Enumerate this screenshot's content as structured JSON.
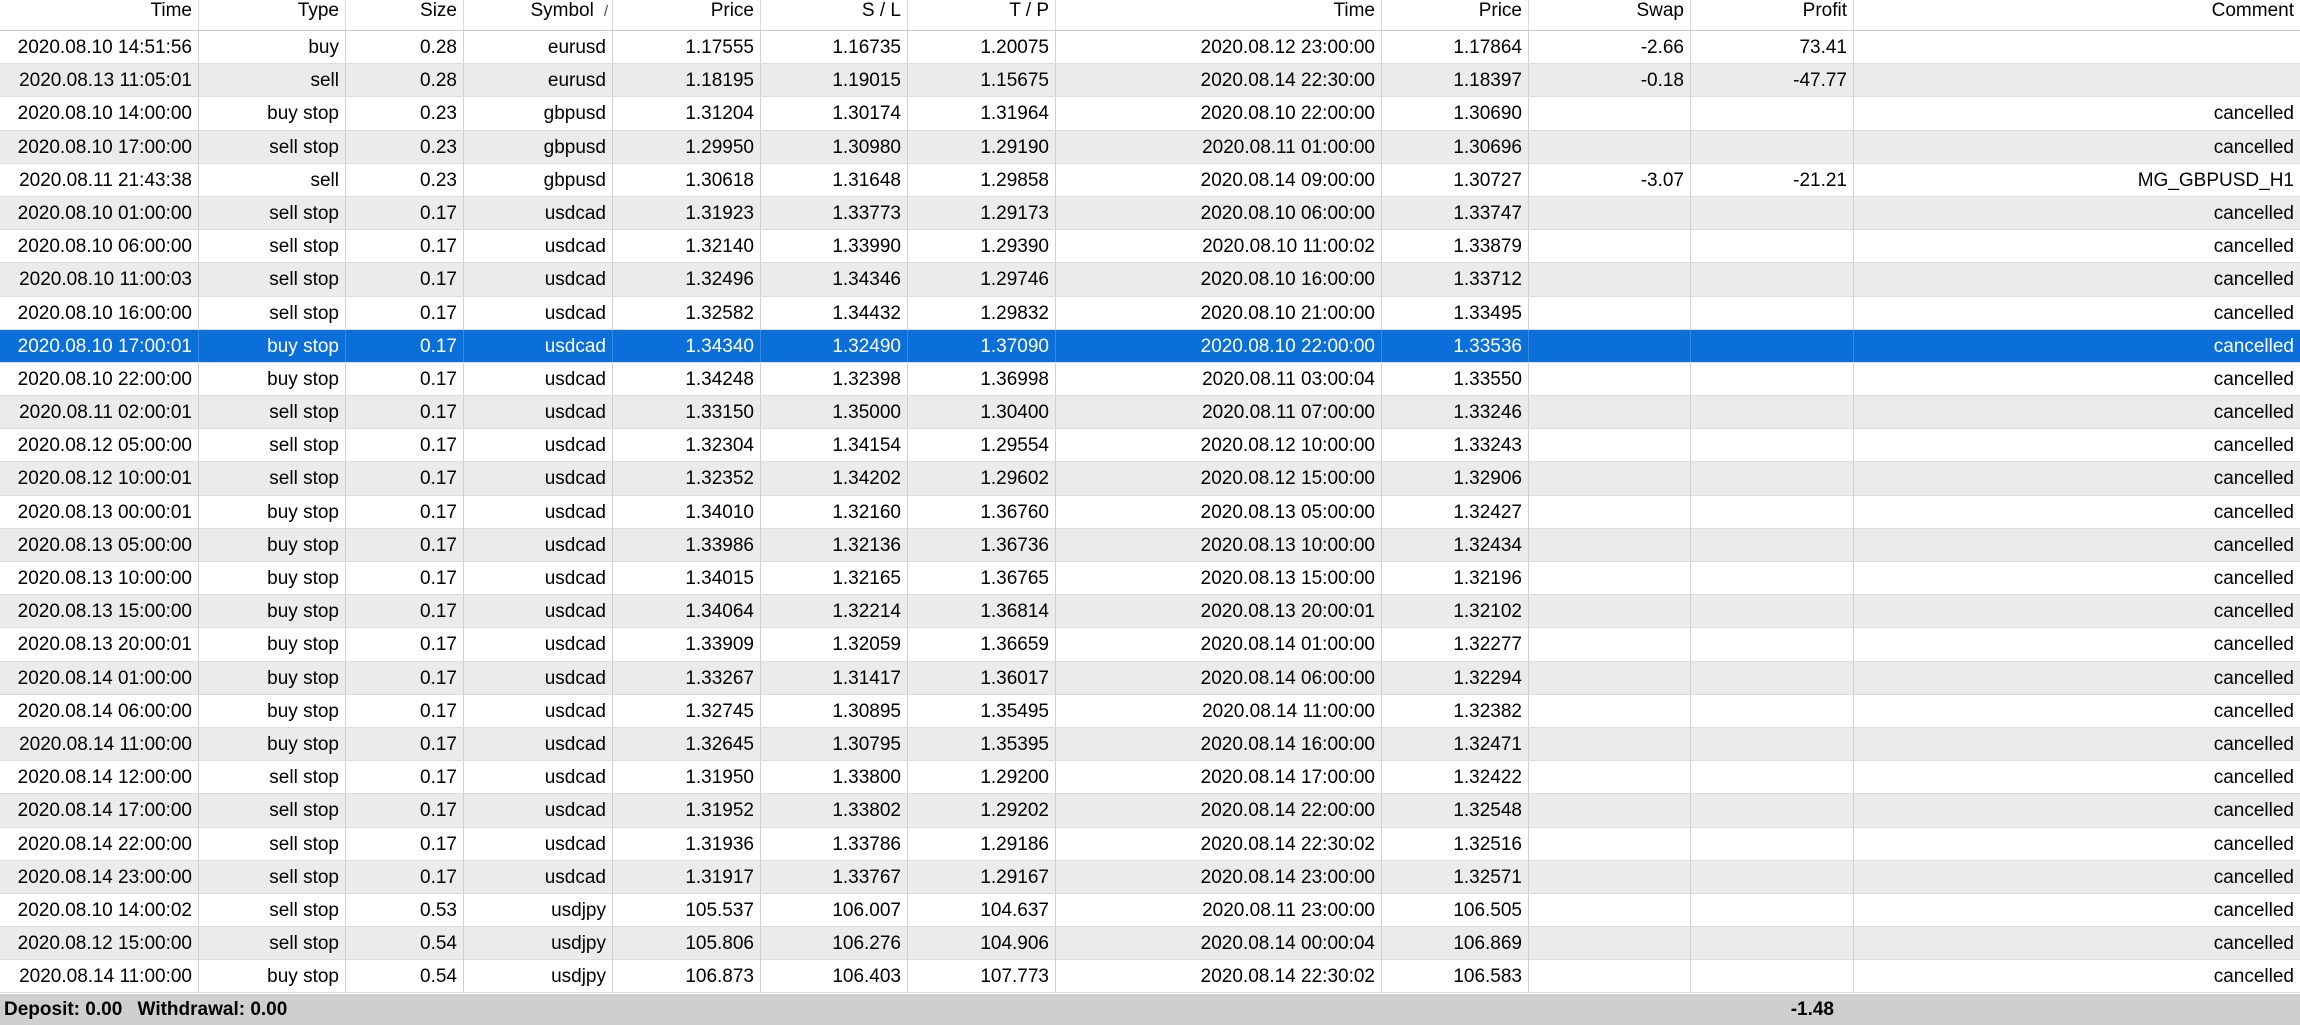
{
  "columns": [
    "Time",
    "Type",
    "Size",
    "Symbol",
    "Price",
    "S / L",
    "T / P",
    "Time",
    "Price",
    "Swap",
    "Profit",
    "Comment"
  ],
  "sort_indicator": "/",
  "rows": [
    [
      "2020.08.10 14:51:56",
      "buy",
      "0.28",
      "eurusd",
      "1.17555",
      "1.16735",
      "1.20075",
      "2020.08.12 23:00:00",
      "1.17864",
      "-2.66",
      "73.41",
      ""
    ],
    [
      "2020.08.13 11:05:01",
      "sell",
      "0.28",
      "eurusd",
      "1.18195",
      "1.19015",
      "1.15675",
      "2020.08.14 22:30:00",
      "1.18397",
      "-0.18",
      "-47.77",
      ""
    ],
    [
      "2020.08.10 14:00:00",
      "buy stop",
      "0.23",
      "gbpusd",
      "1.31204",
      "1.30174",
      "1.31964",
      "2020.08.10 22:00:00",
      "1.30690",
      "",
      "",
      "cancelled"
    ],
    [
      "2020.08.10 17:00:00",
      "sell stop",
      "0.23",
      "gbpusd",
      "1.29950",
      "1.30980",
      "1.29190",
      "2020.08.11 01:00:00",
      "1.30696",
      "",
      "",
      "cancelled"
    ],
    [
      "2020.08.11 21:43:38",
      "sell",
      "0.23",
      "gbpusd",
      "1.30618",
      "1.31648",
      "1.29858",
      "2020.08.14 09:00:00",
      "1.30727",
      "-3.07",
      "-21.21",
      "MG_GBPUSD_H1"
    ],
    [
      "2020.08.10 01:00:00",
      "sell stop",
      "0.17",
      "usdcad",
      "1.31923",
      "1.33773",
      "1.29173",
      "2020.08.10 06:00:00",
      "1.33747",
      "",
      "",
      "cancelled"
    ],
    [
      "2020.08.10 06:00:00",
      "sell stop",
      "0.17",
      "usdcad",
      "1.32140",
      "1.33990",
      "1.29390",
      "2020.08.10 11:00:02",
      "1.33879",
      "",
      "",
      "cancelled"
    ],
    [
      "2020.08.10 11:00:03",
      "sell stop",
      "0.17",
      "usdcad",
      "1.32496",
      "1.34346",
      "1.29746",
      "2020.08.10 16:00:00",
      "1.33712",
      "",
      "",
      "cancelled"
    ],
    [
      "2020.08.10 16:00:00",
      "sell stop",
      "0.17",
      "usdcad",
      "1.32582",
      "1.34432",
      "1.29832",
      "2020.08.10 21:00:00",
      "1.33495",
      "",
      "",
      "cancelled"
    ],
    [
      "2020.08.10 17:00:01",
      "buy stop",
      "0.17",
      "usdcad",
      "1.34340",
      "1.32490",
      "1.37090",
      "2020.08.10 22:00:00",
      "1.33536",
      "",
      "",
      "cancelled"
    ],
    [
      "2020.08.10 22:00:00",
      "buy stop",
      "0.17",
      "usdcad",
      "1.34248",
      "1.32398",
      "1.36998",
      "2020.08.11 03:00:04",
      "1.33550",
      "",
      "",
      "cancelled"
    ],
    [
      "2020.08.11 02:00:01",
      "sell stop",
      "0.17",
      "usdcad",
      "1.33150",
      "1.35000",
      "1.30400",
      "2020.08.11 07:00:00",
      "1.33246",
      "",
      "",
      "cancelled"
    ],
    [
      "2020.08.12 05:00:00",
      "sell stop",
      "0.17",
      "usdcad",
      "1.32304",
      "1.34154",
      "1.29554",
      "2020.08.12 10:00:00",
      "1.33243",
      "",
      "",
      "cancelled"
    ],
    [
      "2020.08.12 10:00:01",
      "sell stop",
      "0.17",
      "usdcad",
      "1.32352",
      "1.34202",
      "1.29602",
      "2020.08.12 15:00:00",
      "1.32906",
      "",
      "",
      "cancelled"
    ],
    [
      "2020.08.13 00:00:01",
      "buy stop",
      "0.17",
      "usdcad",
      "1.34010",
      "1.32160",
      "1.36760",
      "2020.08.13 05:00:00",
      "1.32427",
      "",
      "",
      "cancelled"
    ],
    [
      "2020.08.13 05:00:00",
      "buy stop",
      "0.17",
      "usdcad",
      "1.33986",
      "1.32136",
      "1.36736",
      "2020.08.13 10:00:00",
      "1.32434",
      "",
      "",
      "cancelled"
    ],
    [
      "2020.08.13 10:00:00",
      "buy stop",
      "0.17",
      "usdcad",
      "1.34015",
      "1.32165",
      "1.36765",
      "2020.08.13 15:00:00",
      "1.32196",
      "",
      "",
      "cancelled"
    ],
    [
      "2020.08.13 15:00:00",
      "buy stop",
      "0.17",
      "usdcad",
      "1.34064",
      "1.32214",
      "1.36814",
      "2020.08.13 20:00:01",
      "1.32102",
      "",
      "",
      "cancelled"
    ],
    [
      "2020.08.13 20:00:01",
      "buy stop",
      "0.17",
      "usdcad",
      "1.33909",
      "1.32059",
      "1.36659",
      "2020.08.14 01:00:00",
      "1.32277",
      "",
      "",
      "cancelled"
    ],
    [
      "2020.08.14 01:00:00",
      "buy stop",
      "0.17",
      "usdcad",
      "1.33267",
      "1.31417",
      "1.36017",
      "2020.08.14 06:00:00",
      "1.32294",
      "",
      "",
      "cancelled"
    ],
    [
      "2020.08.14 06:00:00",
      "buy stop",
      "0.17",
      "usdcad",
      "1.32745",
      "1.30895",
      "1.35495",
      "2020.08.14 11:00:00",
      "1.32382",
      "",
      "",
      "cancelled"
    ],
    [
      "2020.08.14 11:00:00",
      "buy stop",
      "0.17",
      "usdcad",
      "1.32645",
      "1.30795",
      "1.35395",
      "2020.08.14 16:00:00",
      "1.32471",
      "",
      "",
      "cancelled"
    ],
    [
      "2020.08.14 12:00:00",
      "sell stop",
      "0.17",
      "usdcad",
      "1.31950",
      "1.33800",
      "1.29200",
      "2020.08.14 17:00:00",
      "1.32422",
      "",
      "",
      "cancelled"
    ],
    [
      "2020.08.14 17:00:00",
      "sell stop",
      "0.17",
      "usdcad",
      "1.31952",
      "1.33802",
      "1.29202",
      "2020.08.14 22:00:00",
      "1.32548",
      "",
      "",
      "cancelled"
    ],
    [
      "2020.08.14 22:00:00",
      "sell stop",
      "0.17",
      "usdcad",
      "1.31936",
      "1.33786",
      "1.29186",
      "2020.08.14 22:30:02",
      "1.32516",
      "",
      "",
      "cancelled"
    ],
    [
      "2020.08.14 23:00:00",
      "sell stop",
      "0.17",
      "usdcad",
      "1.31917",
      "1.33767",
      "1.29167",
      "2020.08.14 23:00:00",
      "1.32571",
      "",
      "",
      "cancelled"
    ],
    [
      "2020.08.10 14:00:02",
      "sell stop",
      "0.53",
      "usdjpy",
      "105.537",
      "106.007",
      "104.637",
      "2020.08.11 23:00:00",
      "106.505",
      "",
      "",
      "cancelled"
    ],
    [
      "2020.08.12 15:00:00",
      "sell stop",
      "0.54",
      "usdjpy",
      "105.806",
      "106.276",
      "104.906",
      "2020.08.14 00:00:04",
      "106.869",
      "",
      "",
      "cancelled"
    ],
    [
      "2020.08.14 11:00:00",
      "buy stop",
      "0.54",
      "usdjpy",
      "106.873",
      "106.403",
      "107.773",
      "2020.08.14 22:30:02",
      "106.583",
      "",
      "",
      "cancelled"
    ]
  ],
  "selected_row": 9,
  "footer": {
    "deposit": "Deposit: 0.00",
    "withdrawal": "Withdrawal: 0.00",
    "total_profit": "-1.48"
  },
  "colors": {
    "selection": "#0a6fd8",
    "row_alt": "#ebebeb",
    "footer_bg": "#cfcfcf"
  }
}
